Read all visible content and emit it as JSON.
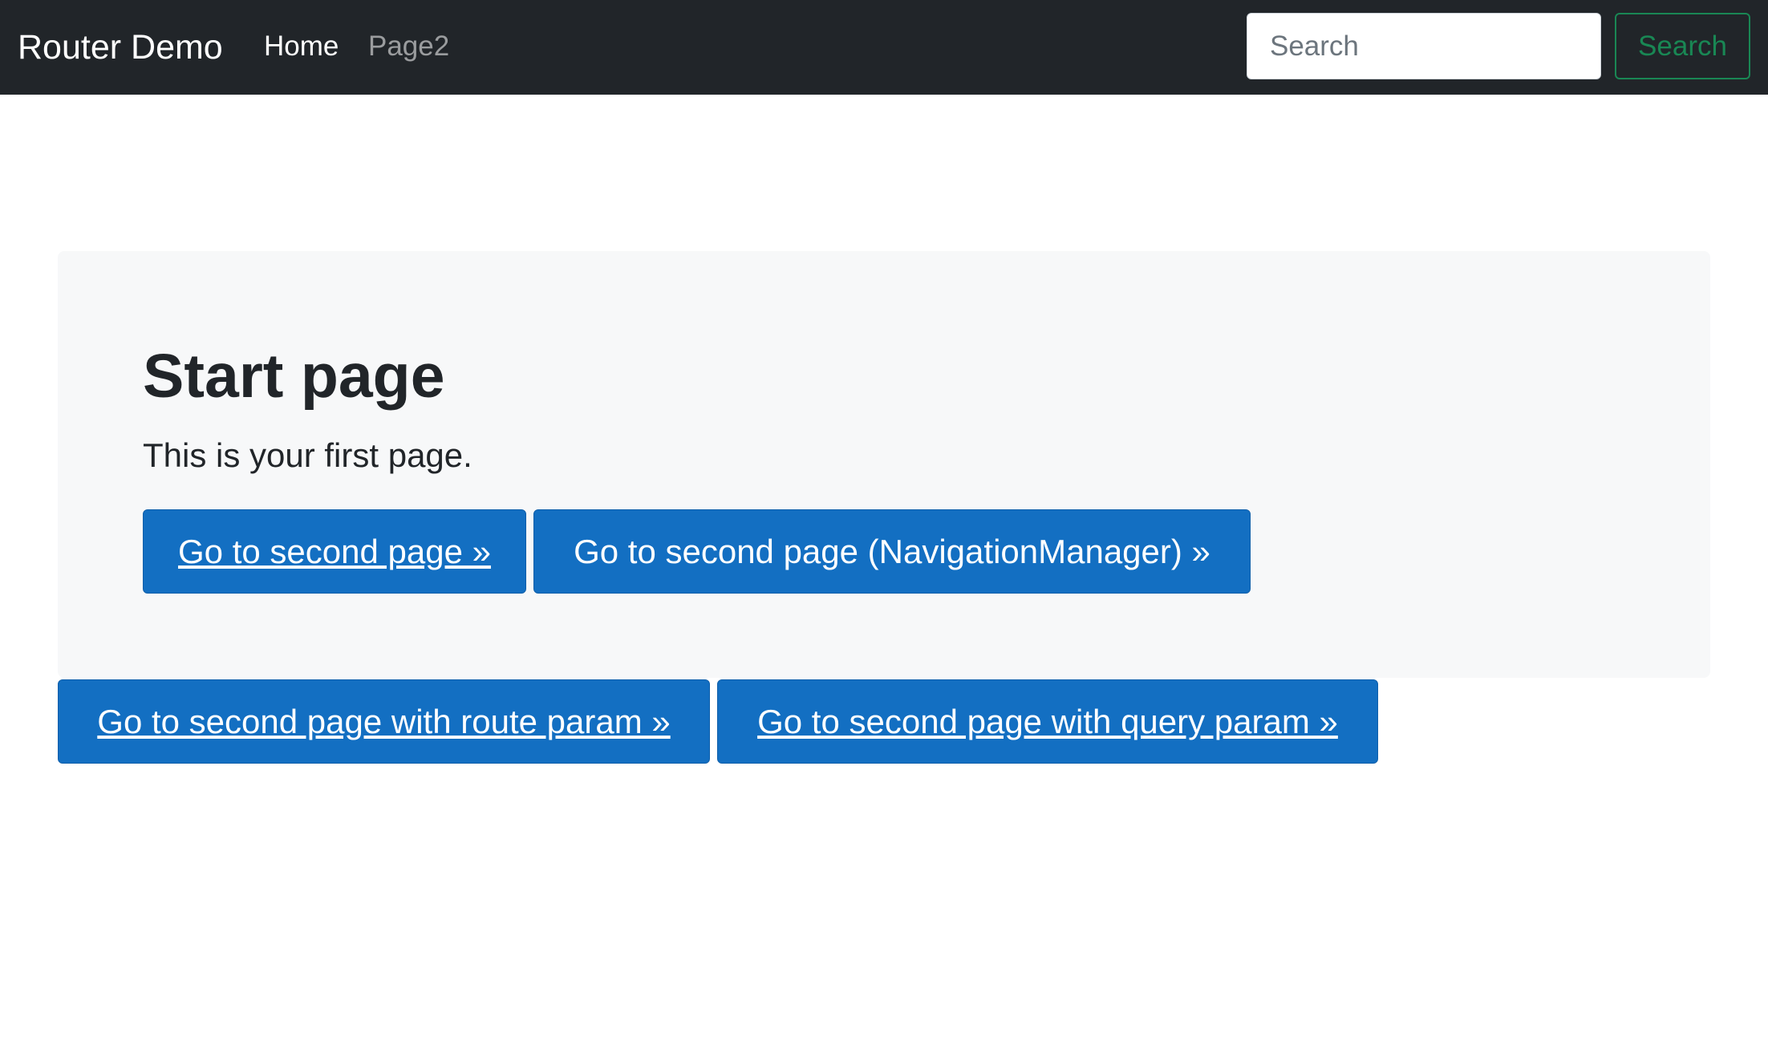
{
  "navbar": {
    "brand": "Router Demo",
    "links": [
      {
        "label": "Home",
        "active": true
      },
      {
        "label": "Page2",
        "active": false
      }
    ],
    "search": {
      "placeholder": "Search",
      "value": "",
      "button_label": "Search"
    }
  },
  "main": {
    "title": "Start page",
    "lead": "This is your first page.",
    "buttons": [
      {
        "label": "Go to second page »"
      },
      {
        "label": "Go to second page (NavigationManager) »"
      }
    ],
    "extra_buttons": [
      {
        "label": "Go to second page with route param »"
      },
      {
        "label": "Go to second page with query param »"
      }
    ]
  },
  "colors": {
    "navbar_bg": "#212529",
    "primary": "#136fc2",
    "success_outline": "#198754",
    "jumbotron_bg": "#f7f8f9"
  }
}
